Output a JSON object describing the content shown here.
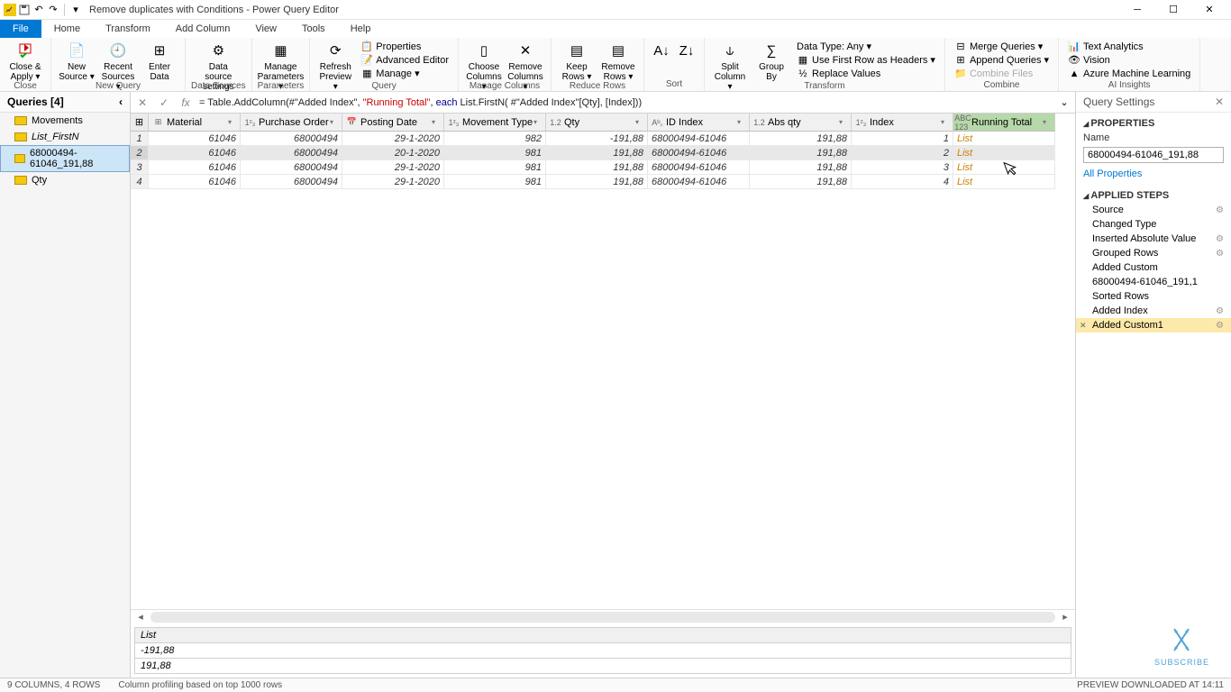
{
  "window": {
    "title": "Remove duplicates with Conditions - Power Query Editor"
  },
  "menu": {
    "file": "File",
    "home": "Home",
    "transform": "Transform",
    "add_column": "Add Column",
    "view": "View",
    "tools": "Tools",
    "help": "Help"
  },
  "ribbon": {
    "close": {
      "name": "Close & Apply ▾",
      "group": "Close"
    },
    "new_source": "New Source ▾",
    "recent_sources": "Recent Sources ▾",
    "enter_data": "Enter Data",
    "new_query": "New Query",
    "data_source_settings": "Data source settings",
    "data_sources": "Data Sources",
    "manage_params": "Manage Parameters ▾",
    "parameters": "Parameters",
    "refresh": "Refresh Preview ▾",
    "properties": "Properties",
    "adv_editor": "Advanced Editor",
    "manage": "Manage ▾",
    "query": "Query",
    "choose_cols": "Choose Columns ▾",
    "remove_cols": "Remove Columns ▾",
    "manage_columns": "Manage Columns",
    "keep_rows": "Keep Rows ▾",
    "remove_rows": "Remove Rows ▾",
    "reduce_rows": "Reduce Rows",
    "sort": "Sort",
    "split_col": "Split Column ▾",
    "group_by": "Group By",
    "datatype": "Data Type: Any ▾",
    "first_row_headers": "Use First Row as Headers ▾",
    "replace_values": "Replace Values",
    "transform": "Transform",
    "merge_queries": "Merge Queries ▾",
    "append_queries": "Append Queries ▾",
    "combine_files": "Combine Files",
    "combine": "Combine",
    "text_analytics": "Text Analytics",
    "vision": "Vision",
    "azure_ml": "Azure Machine Learning",
    "ai": "AI Insights"
  },
  "queries": {
    "header": "Queries [4]",
    "items": [
      {
        "name": "Movements",
        "italic": false,
        "selected": false
      },
      {
        "name": "List_FirstN",
        "italic": true,
        "selected": false
      },
      {
        "name": "68000494-61046_191,88",
        "italic": false,
        "selected": true
      },
      {
        "name": "Qty",
        "italic": false,
        "selected": false
      }
    ]
  },
  "formula": {
    "prefix": "= Table.AddColumn(#\"Added Index\", ",
    "rt": "\"Running Total\"",
    "mid": ", ",
    "kw": "each",
    "suffix": " List.FirstN( #\"Added Index\"[Qty], [Index]))"
  },
  "columns": [
    {
      "label": "Material",
      "icon": "⊞",
      "selected": false
    },
    {
      "label": "Purchase Order",
      "icon": "1²₃",
      "selected": false
    },
    {
      "label": "Posting Date",
      "icon": "📅",
      "selected": false
    },
    {
      "label": "Movement Type",
      "icon": "1²₃",
      "selected": false
    },
    {
      "label": "Qty",
      "icon": "1.2",
      "selected": false
    },
    {
      "label": "ID Index",
      "icon": "Aᵇ꜀",
      "selected": false
    },
    {
      "label": "Abs qty",
      "icon": "1.2",
      "selected": false
    },
    {
      "label": "Index",
      "icon": "1²₃",
      "selected": false
    },
    {
      "label": "Running Total",
      "icon": "ABC 123",
      "selected": true
    }
  ],
  "rows": [
    {
      "n": "1",
      "material": "61046",
      "po": "68000494",
      "date": "29-1-2020",
      "mt": "982",
      "qty": "-191,88",
      "id": "68000494-61046",
      "abs": "191,88",
      "index": "1",
      "rt": "List"
    },
    {
      "n": "2",
      "material": "61046",
      "po": "68000494",
      "date": "20-1-2020",
      "mt": "981",
      "qty": "191,88",
      "id": "68000494-61046",
      "abs": "191,88",
      "index": "2",
      "rt": "List"
    },
    {
      "n": "3",
      "material": "61046",
      "po": "68000494",
      "date": "29-1-2020",
      "mt": "981",
      "qty": "191,88",
      "id": "68000494-61046",
      "abs": "191,88",
      "index": "3",
      "rt": "List"
    },
    {
      "n": "4",
      "material": "61046",
      "po": "68000494",
      "date": "29-1-2020",
      "mt": "981",
      "qty": "191,88",
      "id": "68000494-61046",
      "abs": "191,88",
      "index": "4",
      "rt": "List"
    }
  ],
  "preview": {
    "header": "List",
    "r1": "-191,88",
    "r2": "191,88"
  },
  "settings": {
    "header": "Query Settings",
    "prop_section": "PROPERTIES",
    "name_label": "Name",
    "name_value": "68000494-61046_191,88",
    "all_props": "All Properties",
    "steps_section": "APPLIED STEPS",
    "steps": [
      {
        "label": "Source",
        "gear": true
      },
      {
        "label": "Changed Type",
        "gear": false
      },
      {
        "label": "Inserted Absolute Value",
        "gear": true
      },
      {
        "label": "Grouped Rows",
        "gear": true
      },
      {
        "label": "Added Custom",
        "gear": false
      },
      {
        "label": "68000494-61046_191,1",
        "gear": false
      },
      {
        "label": "Sorted Rows",
        "gear": false
      },
      {
        "label": "Added Index",
        "gear": true
      },
      {
        "label": "Added Custom1",
        "gear": true,
        "selected": true
      }
    ]
  },
  "statusbar": {
    "left": "9 COLUMNS, 4 ROWS",
    "mid": "Column profiling based on top 1000 rows",
    "right": "PREVIEW DOWNLOADED AT 14:11"
  },
  "subscribe": "SUBSCRIBE"
}
